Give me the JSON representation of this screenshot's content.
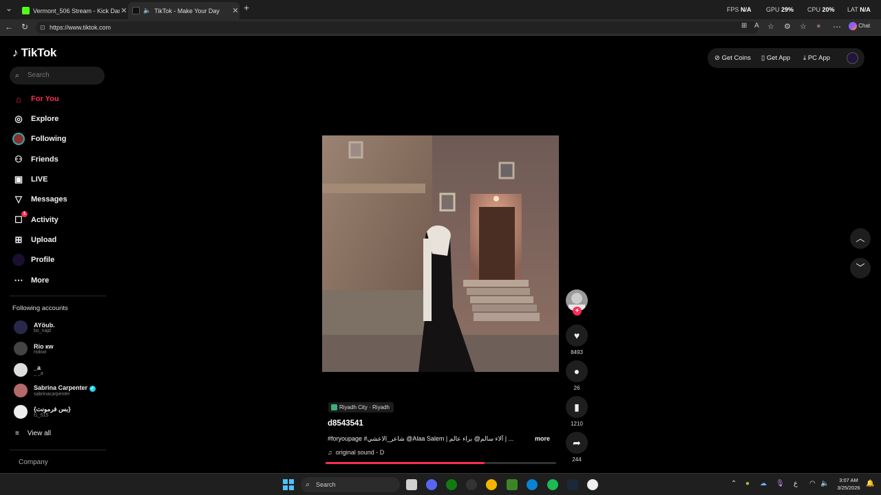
{
  "browser": {
    "tabs": [
      {
        "title": "Vermont_506 Stream - Kick Dashboard",
        "close": "✕"
      },
      {
        "title": "TikTok - Make Your Day",
        "close": "✕"
      }
    ],
    "new_tab": "+",
    "url": "https://www.tiktok.com",
    "chat_label": "Chat",
    "perf": {
      "fps_label": "FPS",
      "fps_value": "N/A",
      "gpu_label": "GPU",
      "gpu_value": "29%",
      "cpu_label": "CPU",
      "cpu_value": "20%",
      "lat_label": "LAT",
      "lat_value": "N/A"
    }
  },
  "sidebar": {
    "logo": "TikTok",
    "search_placeholder": "Search",
    "nav": [
      {
        "label": "For You",
        "icon": "home-icon"
      },
      {
        "label": "Explore",
        "icon": "compass-icon"
      },
      {
        "label": "Following",
        "icon": "following-avatar-icon"
      },
      {
        "label": "Friends",
        "icon": "friends-icon"
      },
      {
        "label": "LIVE",
        "icon": "live-icon"
      },
      {
        "label": "Messages",
        "icon": "messages-icon"
      },
      {
        "label": "Activity",
        "icon": "activity-icon",
        "badge": "1"
      },
      {
        "label": "Upload",
        "icon": "upload-icon"
      },
      {
        "label": "Profile",
        "icon": "profile-icon"
      },
      {
        "label": "More",
        "icon": "more-icon"
      }
    ],
    "following_title": "Following accounts",
    "accounts": [
      {
        "name": "AYöub.",
        "handle": "bo_najd"
      },
      {
        "name": "Rio кw",
        "handle": "riokwt"
      },
      {
        "name": "_a",
        "handle": "_ _a"
      },
      {
        "name": "Sabrina Carpenter",
        "handle": "sabrinacarpenter"
      },
      {
        "name": "{بس فرمونت}",
        "handle": "f1_515"
      }
    ],
    "view_all": "View all",
    "company": "Company"
  },
  "topbar": {
    "get_coins": "Get Coins",
    "get_app": "Get App",
    "pc_app": "PC App"
  },
  "post": {
    "location": "Riyadh City · Riyadh",
    "author": "d8543541",
    "caption": "#foryoupage #شاعر_الاعشي @Alaa Salem | آلاء سالم@ براء عالم | ...",
    "more": "more",
    "sound": "original sound - D",
    "progress_pct": 69,
    "likes": "8493",
    "comments": "26",
    "saves": "1210",
    "shares": "244"
  },
  "taskbar": {
    "search": "Search",
    "time": "3:07 AM",
    "date": "3/25/2026",
    "lang": "ع"
  },
  "colors": {
    "accent": "#fe2c55",
    "background": "#000000",
    "panel": "#1e1e1e"
  }
}
